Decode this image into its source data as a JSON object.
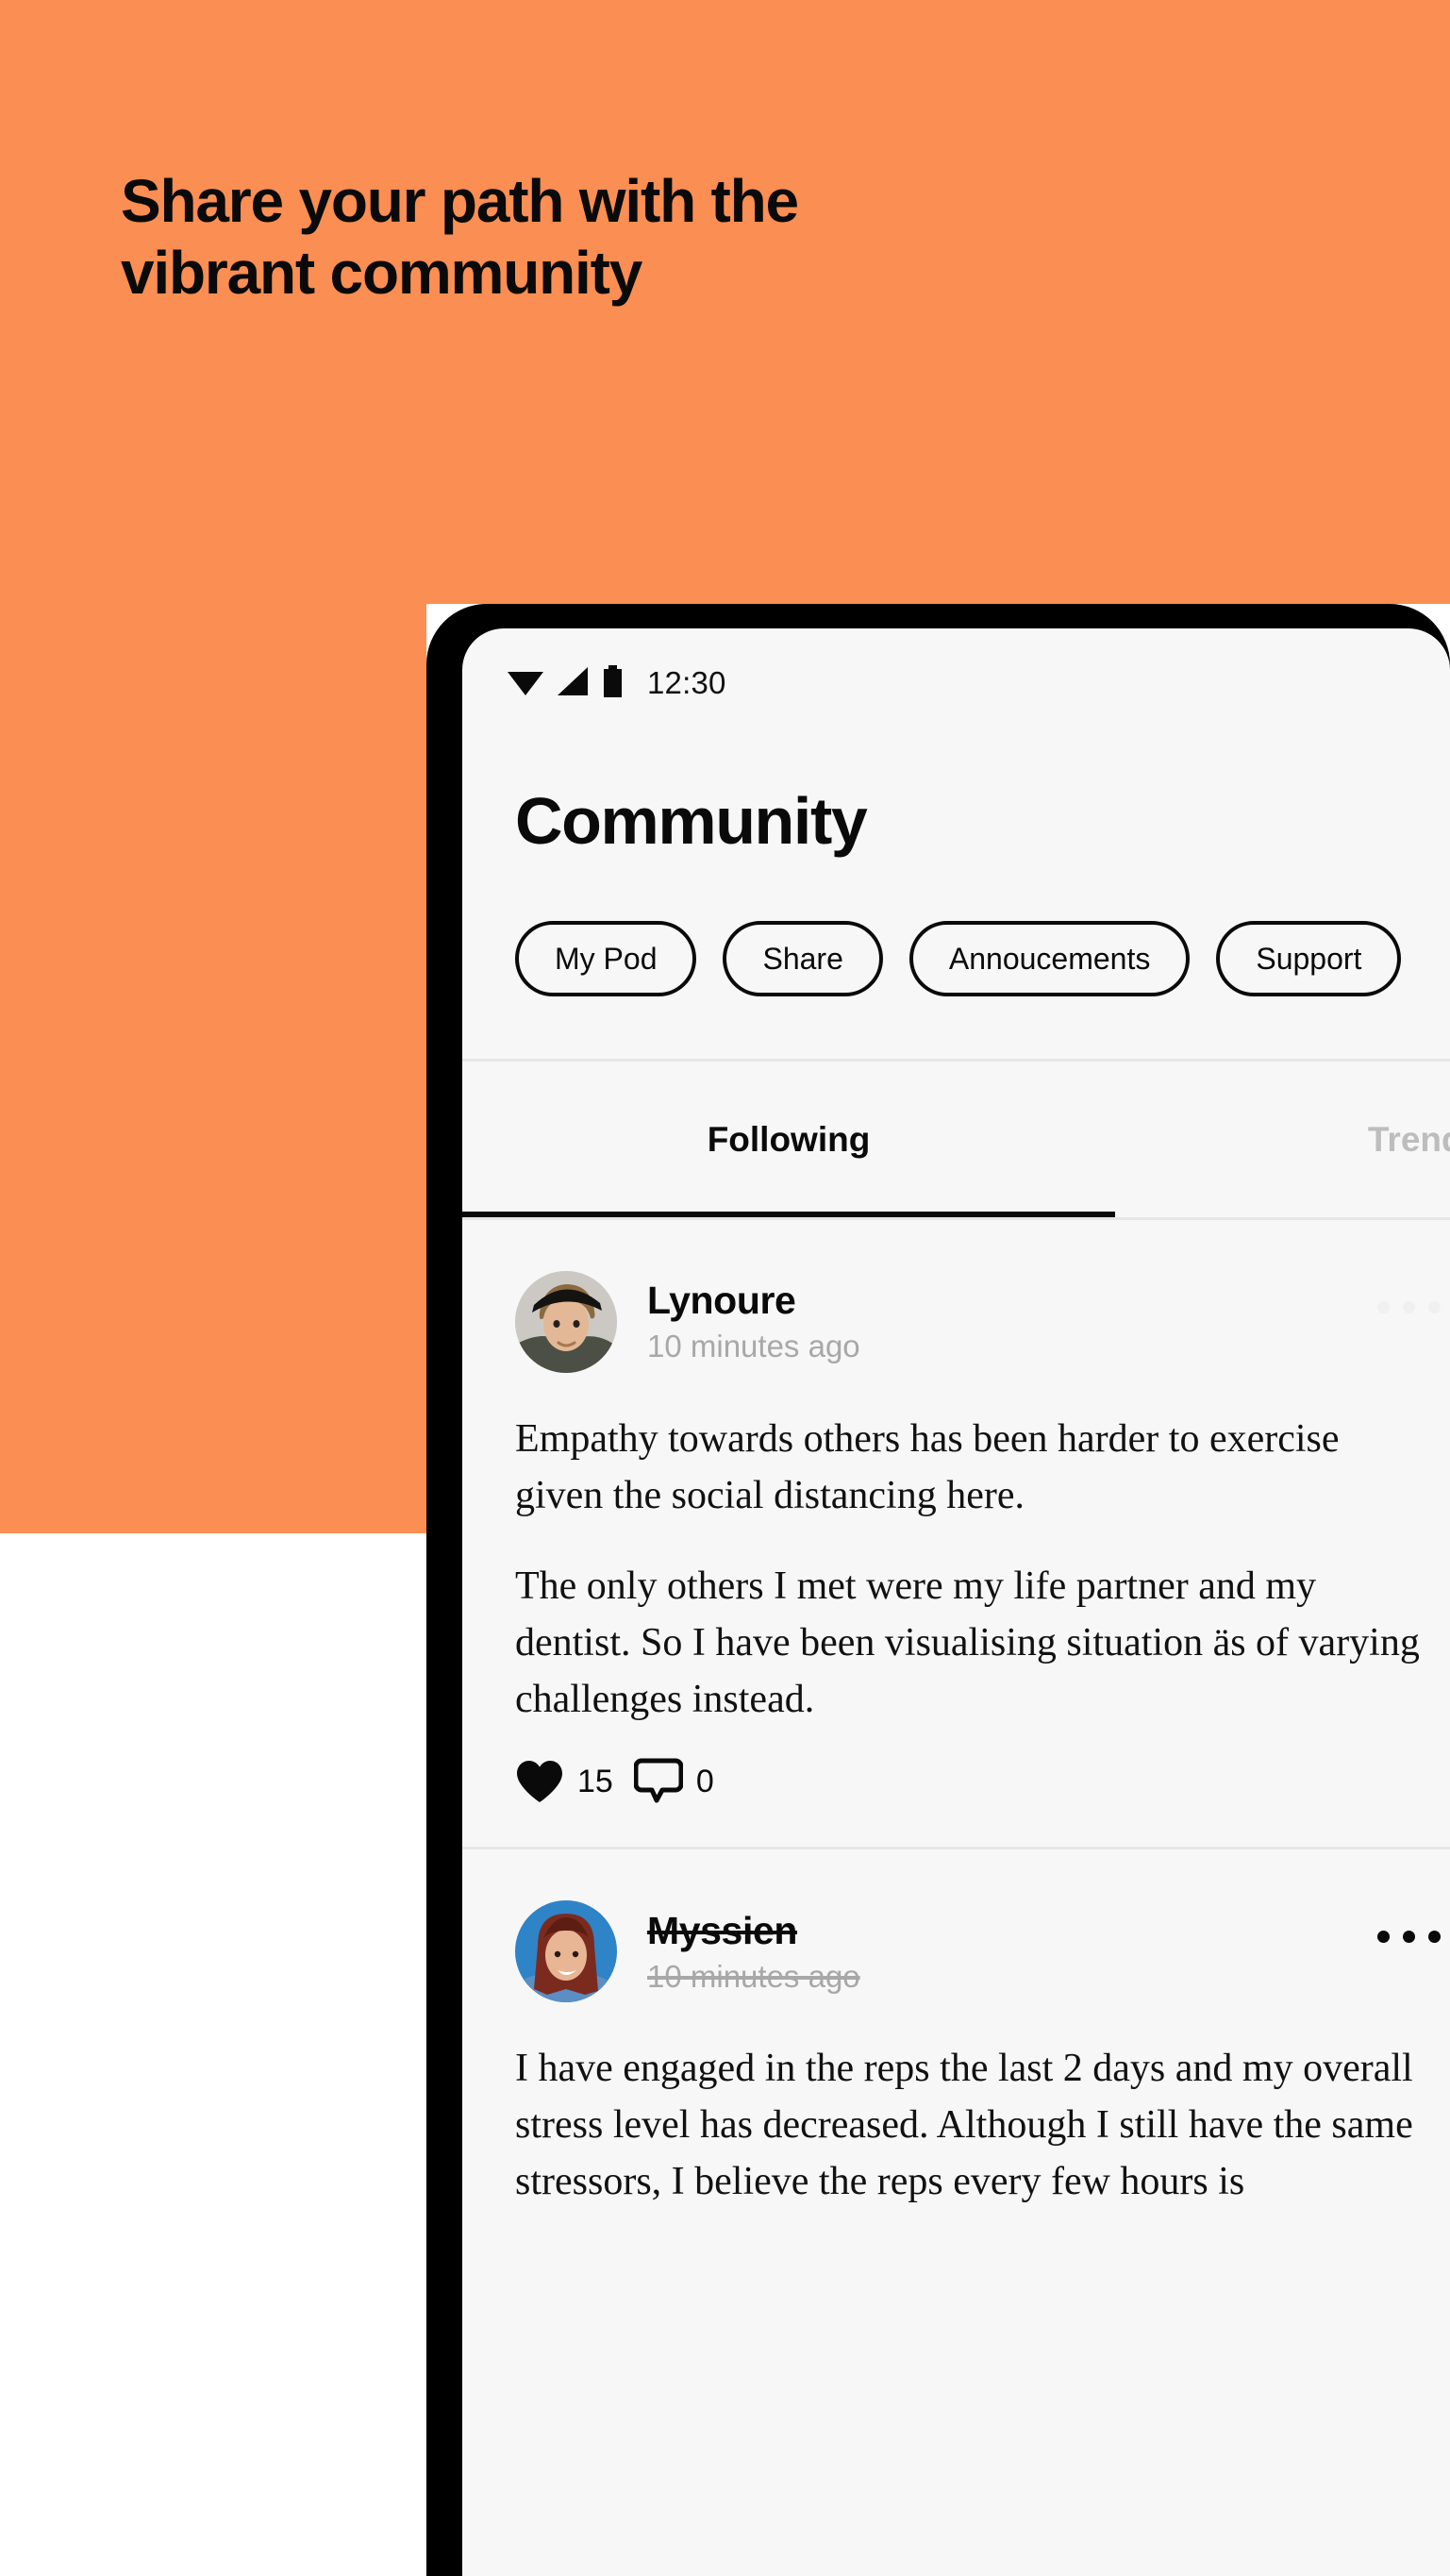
{
  "promo": {
    "headline": "Share your path with the\nvibrant community",
    "background_color": "#fb8e52"
  },
  "status_bar": {
    "time": "12:30",
    "icons": [
      "wifi-icon",
      "cellular-signal-icon",
      "battery-icon"
    ]
  },
  "screen": {
    "title": "Community",
    "chips": [
      {
        "label": "My Pod"
      },
      {
        "label": "Share"
      },
      {
        "label": "Annoucements"
      },
      {
        "label": "Support"
      }
    ],
    "tabs": [
      {
        "label": "Following",
        "active": true
      },
      {
        "label": "Trending",
        "active": false
      }
    ],
    "posts": [
      {
        "author": "Lynoure",
        "timestamp": "10 minutes ago",
        "struck_through": false,
        "avatar": "portrait-person-hat",
        "paragraphs": [
          "Empathy towards others has been harder to exercise given the social distancing here.",
          "The only others I met were my life partner and my dentist. So I have been visualising situation äs of varying challenges instead."
        ],
        "likes": "15",
        "comments": "0",
        "show_reactions": true,
        "menu_faint": true
      },
      {
        "author": "Myssien",
        "timestamp": "10 minutes ago",
        "struck_through": true,
        "avatar": "portrait-person-blue-sky",
        "paragraphs": [
          "I have engaged in the reps the last 2 days and my overall stress level has decreased. Although I still have the same stressors, I believe the reps every few hours is"
        ],
        "likes": "",
        "comments": "",
        "show_reactions": false,
        "menu_faint": false
      }
    ]
  },
  "colors": {
    "accent_orange": "#fb8e52",
    "screen_bg": "#f7f7f7",
    "text_primary": "#0a0a0a",
    "text_muted": "#a8a8a8",
    "divider": "#e6e6e6"
  }
}
